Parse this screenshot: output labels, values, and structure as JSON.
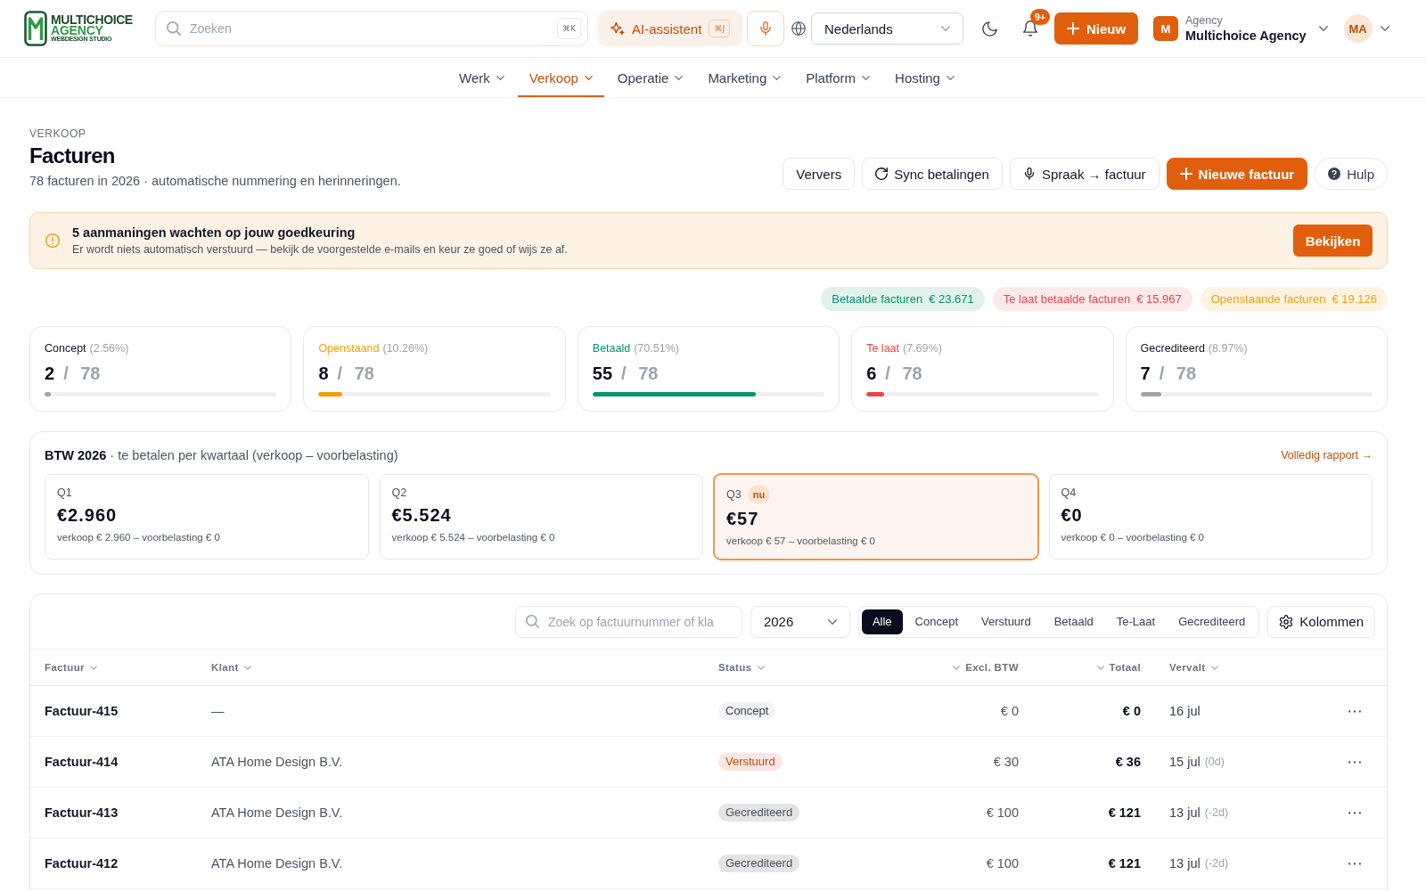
{
  "top_bar": {
    "logo": {
      "line_1": "MULTICHOICE",
      "line_2": "AGENCY",
      "tagline": "WEBDESIGN STUDIO"
    },
    "search": {
      "placeholder": "Zoeken",
      "shortcut": "⌘K"
    },
    "ai_assistant": {
      "label": "AI-assistent",
      "shortcut": "⌘J"
    },
    "language": {
      "value": "Nederlands"
    },
    "notifications": {
      "badge": "9+"
    },
    "new_button": {
      "label": "Nieuw"
    },
    "workspace": {
      "initial": "M",
      "caption": "Agency",
      "name": "Multichoice Agency"
    },
    "user": {
      "initials": "MA"
    }
  },
  "nav": [
    {
      "label": "Werk",
      "selected": false
    },
    {
      "label": "Verkoop",
      "selected": true
    },
    {
      "label": "Operatie",
      "selected": false
    },
    {
      "label": "Marketing",
      "selected": false
    },
    {
      "label": "Platform",
      "selected": false
    },
    {
      "label": "Hosting",
      "selected": false
    }
  ],
  "page_header": {
    "eyebrow": "VERKOOP",
    "title": "Facturen",
    "subtitle": "78 facturen in 2026 · automatische nummering en herinneringen.",
    "actions": {
      "refresh": {
        "label": "Ververs"
      },
      "sync": {
        "label": "Sync betalingen"
      },
      "voice": {
        "label": "Spraak → factuur"
      },
      "new_invoice": {
        "label": "Nieuwe factuur"
      },
      "help": {
        "label": "Hulp"
      }
    }
  },
  "alert": {
    "title": "5 aanmaningen wachten op jouw goedkeuring",
    "text": "Er wordt niets automatisch verstuurd — bekijk de voorgestelde e-mails en keur ze goed of wijs ze af.",
    "button": "Bekijken"
  },
  "summary": [
    {
      "label": "Betaalde facturen",
      "amount": "€ 23.671",
      "color": "#059669"
    },
    {
      "label": "Te laat betaalde facturen",
      "amount": "€ 15.967",
      "color": "#e5484d"
    },
    {
      "label": "Openstaande facturen",
      "amount": "€ 19.126",
      "color": "#f59e0b"
    }
  ],
  "stats": [
    {
      "label": "Concept",
      "share": "(2.56%)",
      "count": "2",
      "total": "/ 78",
      "level": 0.0256,
      "color": "#9ca3af",
      "label_colored": false
    },
    {
      "label": "Openstaand",
      "share": "(10.26%)",
      "count": "8",
      "total": "/ 78",
      "level": 0.1026,
      "color": "#f59e0b",
      "label_colored": true
    },
    {
      "label": "Betaald",
      "share": "(70.51%)",
      "count": "55",
      "total": "/ 78",
      "level": 0.7051,
      "color": "#059669",
      "label_colored": true
    },
    {
      "label": "Te laat",
      "share": "(7.69%)",
      "count": "6",
      "total": "/ 78",
      "level": 0.0769,
      "color": "#ef4444",
      "label_colored": true
    },
    {
      "label": "Gecrediteerd",
      "share": "(8.97%)",
      "count": "7",
      "total": "/ 78",
      "level": 0.0897,
      "color": "#a3a3a3",
      "label_colored": false
    }
  ],
  "vat": {
    "title": "**BTW 2026** · te betalen per kwartaal (verkoop – voorbelasting)",
    "link": "Volledig rapport →",
    "quarters": [
      {
        "label": "Q1",
        "amount": "€2.960",
        "detail": "verkoop € 2.960 – voorbelasting € 0",
        "selected": false
      },
      {
        "label": "Q2",
        "amount": "€5.524",
        "detail": "verkoop € 5.524 – voorbelasting € 0",
        "selected": false
      },
      {
        "label": "Q3",
        "badge": "nu",
        "amount": "€57",
        "detail": "verkoop € 57 – voorbelasting € 0",
        "selected": true
      },
      {
        "label": "Q4",
        "amount": "€0",
        "detail": "verkoop € 0 – voorbelasting € 0",
        "selected": false
      }
    ]
  },
  "invoices": {
    "search": {
      "placeholder": "Zoek op factuurnummer of kla"
    },
    "year_select": {
      "value": "2026"
    },
    "filters": [
      {
        "label": "Alle",
        "selected": true
      },
      {
        "label": "Concept",
        "selected": false
      },
      {
        "label": "Verstuurd",
        "selected": false
      },
      {
        "label": "Betaald",
        "selected": false
      },
      {
        "label": "Te-Laat",
        "selected": false
      },
      {
        "label": "Gecrediteerd",
        "selected": false
      }
    ],
    "columns_button": {
      "label": "Kolommen"
    },
    "columns": [
      "Factuur",
      "Klant",
      "Status",
      "Excl. BTW",
      "Totaal",
      "Vervalt"
    ],
    "rows": [
      {
        "invoice": "Factuur-415",
        "client": "—",
        "status": {
          "label": "Concept",
          "kind": "concept"
        },
        "excl_vat": "€ 0",
        "total": "€ 0",
        "due": "16 jul"
      },
      {
        "invoice": "Factuur-414",
        "client": "ATA Home Design B.V.",
        "status": {
          "label": "Verstuurd",
          "kind": "sent"
        },
        "excl_vat": "€ 30",
        "total": "€ 36",
        "due": "15 jul",
        "due_note": "(0d)"
      },
      {
        "invoice": "Factuur-413",
        "client": "ATA Home Design B.V.",
        "status": {
          "label": "Gecrediteerd",
          "kind": "credited"
        },
        "excl_vat": "€ 100",
        "total": "€ 121",
        "due": "13 jul",
        "due_note": "(-2d)"
      },
      {
        "invoice": "Factuur-412",
        "client": "ATA Home Design B.V.",
        "status": {
          "label": "Gecrediteerd",
          "kind": "credited"
        },
        "excl_vat": "€ 100",
        "total": "€ 121",
        "due": "13 jul",
        "due_note": "(-2d)"
      }
    ]
  }
}
